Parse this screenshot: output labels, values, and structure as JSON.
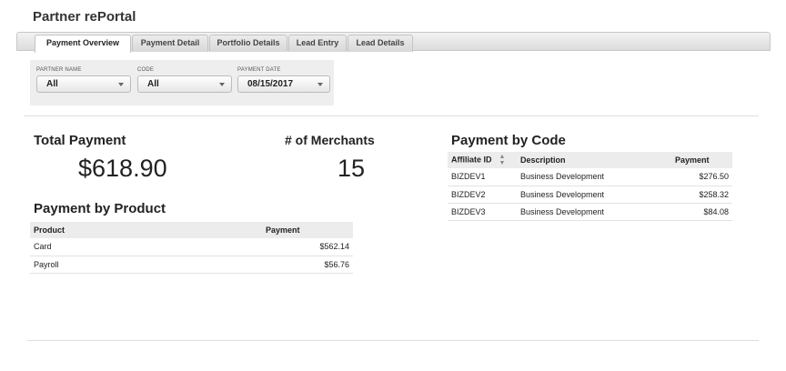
{
  "app": {
    "title": "Partner rePortal"
  },
  "tabs": [
    {
      "label": "Payment Overview",
      "active": true
    },
    {
      "label": "Payment Detail"
    },
    {
      "label": "Portfolio Details"
    },
    {
      "label": "Lead Entry"
    },
    {
      "label": "Lead Details"
    }
  ],
  "filters": {
    "partner_name": {
      "label": "PARTNER NAME",
      "value": "All"
    },
    "code": {
      "label": "CODE",
      "value": "All"
    },
    "payment_date": {
      "label": "PAYMENT DATE",
      "value": "08/15/2017"
    }
  },
  "total_payment": {
    "title": "Total Payment",
    "value": "$618.90"
  },
  "merchants": {
    "title": "# of Merchants",
    "value": "15"
  },
  "payment_by_product": {
    "title": "Payment by Product",
    "columns": [
      "Product",
      "Payment"
    ],
    "rows": [
      {
        "product": "Card",
        "payment": "$562.14"
      },
      {
        "product": "Payroll",
        "payment": "$56.76"
      }
    ]
  },
  "payment_by_code": {
    "title": "Payment by Code",
    "columns": [
      "Affiliate ID",
      "Description",
      "Payment"
    ],
    "sort_icon": "sort-updown-icon",
    "rows": [
      {
        "affiliate_id": "BIZDEV1",
        "description": "Business Development",
        "payment": "$276.50"
      },
      {
        "affiliate_id": "BIZDEV2",
        "description": "Business Development",
        "payment": "$258.32"
      },
      {
        "affiliate_id": "BIZDEV3",
        "description": "Business Development",
        "payment": "$84.08"
      }
    ]
  }
}
